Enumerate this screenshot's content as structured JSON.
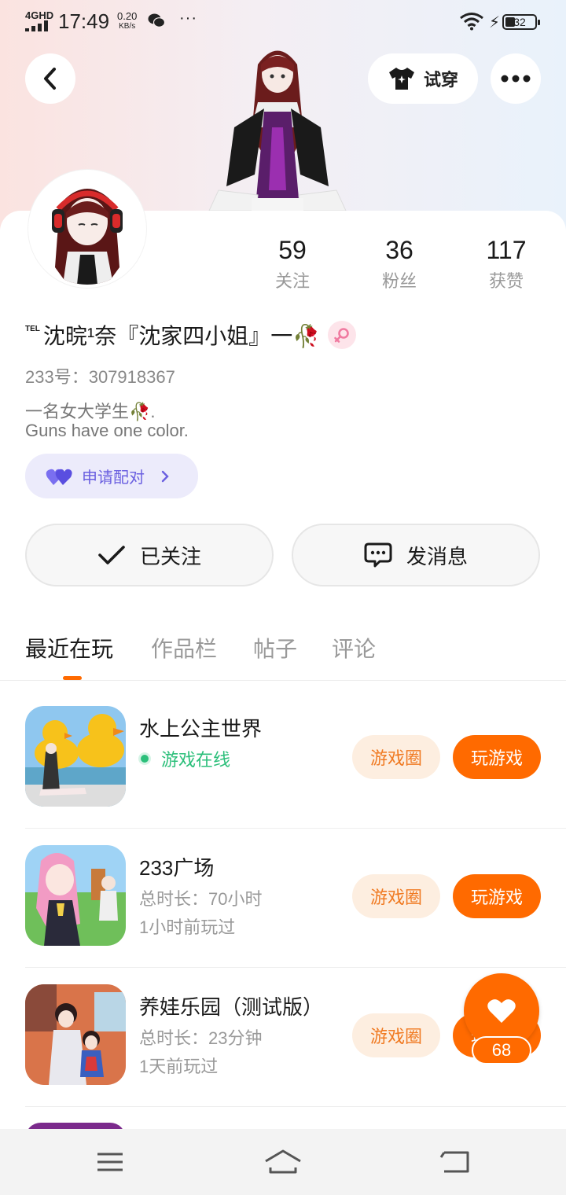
{
  "status_bar": {
    "network": "4GHD",
    "time": "17:49",
    "speed_value": "0.20",
    "speed_unit": "KB/s",
    "more": "···",
    "battery": "32"
  },
  "header": {
    "tryon_label": "试穿"
  },
  "stats": [
    {
      "value": "59",
      "label": "关注"
    },
    {
      "value": "36",
      "label": "粉丝"
    },
    {
      "value": "117",
      "label": "获赞"
    }
  ],
  "profile": {
    "nickname_prefix": "TEL",
    "nickname": "沈晥¹奈『沈家四小姐』一🥀",
    "user_id": "233号：307918367",
    "bio_line1": "一名女大学生🥀.",
    "bio_line2": "Guns have one color.",
    "gender": "female"
  },
  "pair_button": {
    "label": "申请配对"
  },
  "actions": {
    "follow_label": "已关注",
    "message_label": "发消息"
  },
  "tabs": [
    "最近在玩",
    "作品栏",
    "帖子",
    "评论"
  ],
  "games": [
    {
      "name": "水上公主世界",
      "status": "游戏在线",
      "circle_label": "游戏圈",
      "play_label": "玩游戏"
    },
    {
      "name": "233广场",
      "duration": "总时长：70小时",
      "last_played": "1小时前玩过",
      "circle_label": "游戏圈",
      "play_label": "玩游戏"
    },
    {
      "name": "养娃乐园（测试版）",
      "duration": "总时长：23分钟",
      "last_played": "1天前玩过",
      "circle_label": "游戏圈",
      "play_label": "玩游戏"
    }
  ],
  "like_fab": {
    "count": "68"
  },
  "colors": {
    "accent": "#ff6a00",
    "online": "#2bbf7a",
    "pair_purple": "#6a5fe0"
  }
}
